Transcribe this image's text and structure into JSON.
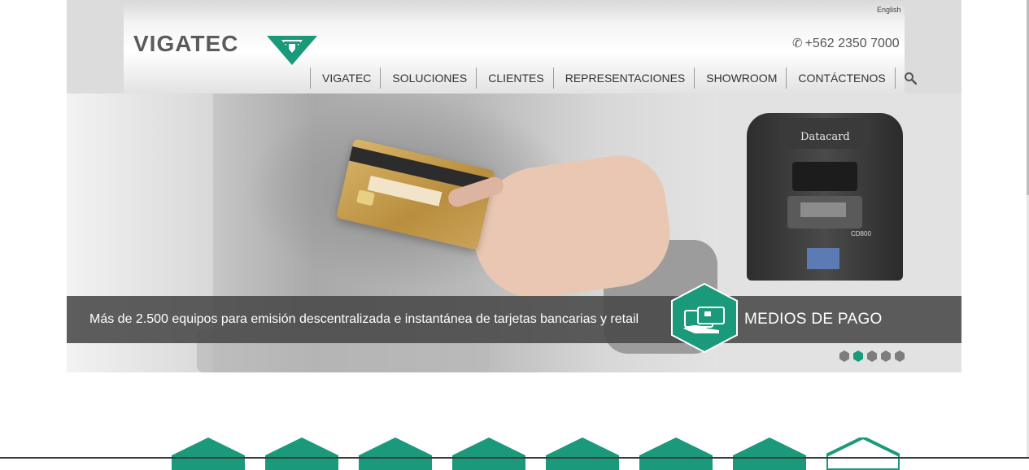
{
  "header": {
    "language_link": "English",
    "logo_text": "VIGATEC",
    "phone": "+562 2350 7000",
    "phone_icon": "phone-icon",
    "nav": [
      {
        "label": "VIGATEC"
      },
      {
        "label": "SOLUCIONES"
      },
      {
        "label": "CLIENTES"
      },
      {
        "label": "REPRESENTACIONES"
      },
      {
        "label": "SHOWROOM"
      },
      {
        "label": "CONTÁCTENOS"
      }
    ],
    "search_icon": "search-icon"
  },
  "hero": {
    "printer_brand": "Datacard",
    "printer_model": "CD800",
    "caption": "Más de 2.500 equipos para emisión descentralizada e instantánea de tarjetas bancarias y retail",
    "category": "MEDIOS DE PAGO",
    "category_icon": "card-payment-icon",
    "slides_total": 5,
    "active_slide": 2
  },
  "services": {
    "icon_count": 8
  },
  "colors": {
    "brand_green": "#1a9a7a",
    "dot_gray": "#7d7d7d",
    "caption_bg": "#484848"
  }
}
